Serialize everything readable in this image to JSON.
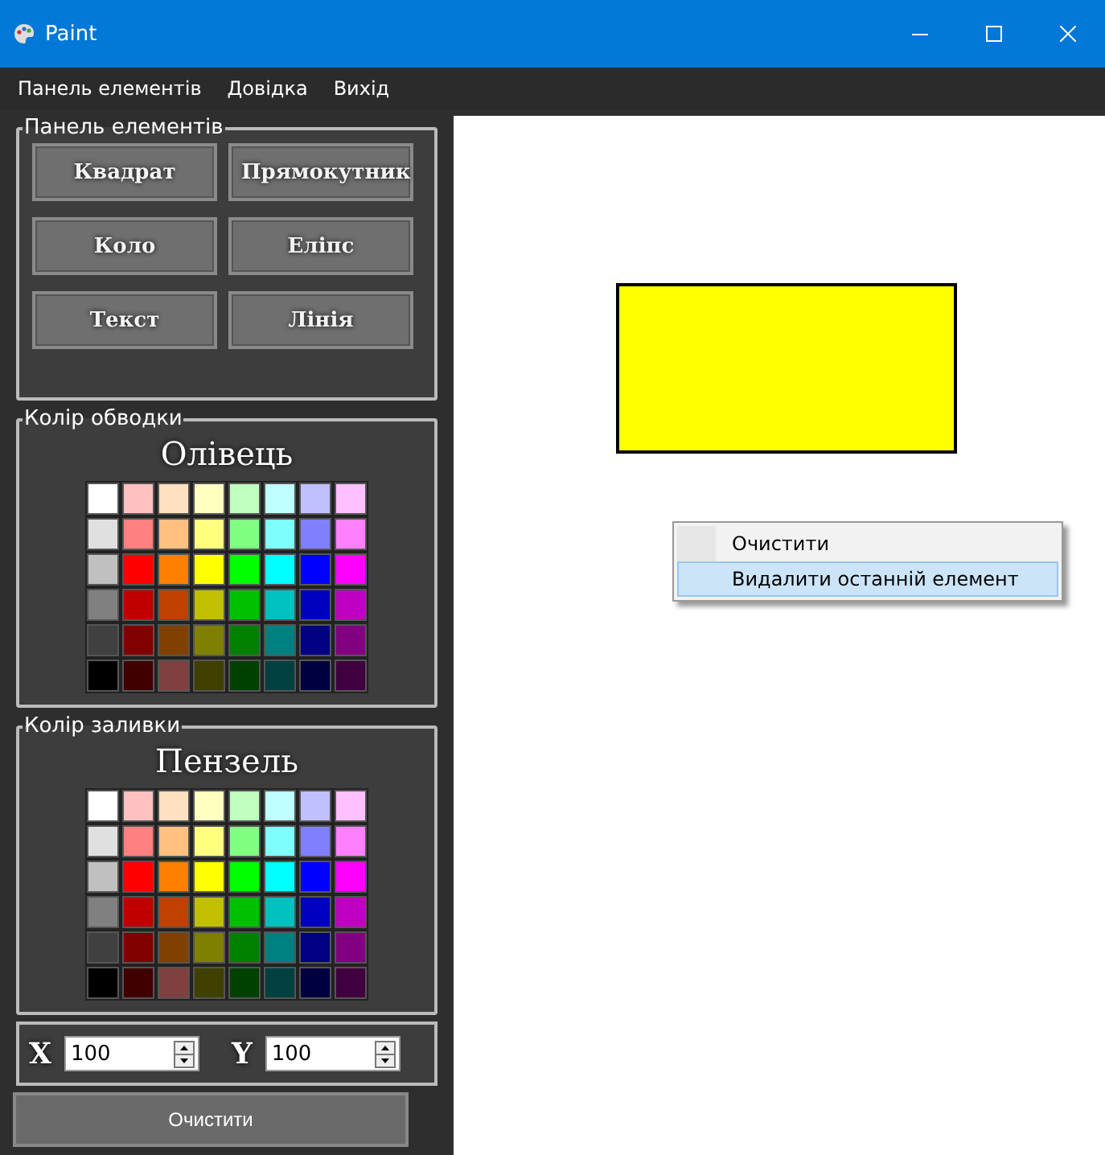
{
  "window": {
    "title": "Paint"
  },
  "menu": [
    "Панель елементів",
    "Довідка",
    "Вихід"
  ],
  "elements_panel": {
    "title": "Панель елементів",
    "buttons": [
      "Квадрат",
      "Прямокутник",
      "Коло",
      "Еліпс",
      "Текст",
      "Лінія"
    ]
  },
  "stroke_panel": {
    "title": "Колір обводки",
    "heading": "Олівець",
    "swatches": [
      {
        "color": "#ffffff"
      },
      {
        "color": "#ffc0c0"
      },
      {
        "color": "#ffe0c0"
      },
      {
        "color": "#ffffc0"
      },
      {
        "color": "#c0ffc0"
      },
      {
        "color": "#c0ffff"
      },
      {
        "color": "#c0c0ff"
      },
      {
        "color": "#ffc0ff"
      },
      {
        "color": "#e0e0e0"
      },
      {
        "color": "#ff8080"
      },
      {
        "color": "#ffc080"
      },
      {
        "color": "#ffff80"
      },
      {
        "color": "#80ff80"
      },
      {
        "color": "#80ffff"
      },
      {
        "color": "#8080ff"
      },
      {
        "color": "#ff80ff"
      },
      {
        "color": "#c0c0c0"
      },
      {
        "color": "#ff0000"
      },
      {
        "color": "#ff8000"
      },
      {
        "color": "#ffff00"
      },
      {
        "color": "#00ff00"
      },
      {
        "color": "#00ffff"
      },
      {
        "color": "#0000ff"
      },
      {
        "color": "#ff00ff"
      },
      {
        "color": "#808080"
      },
      {
        "color": "#c00000"
      },
      {
        "color": "#c04000"
      },
      {
        "color": "#c0c000"
      },
      {
        "color": "#00c000"
      },
      {
        "color": "#00c0c0"
      },
      {
        "color": "#0000c0"
      },
      {
        "color": "#c000c0"
      },
      {
        "color": "#404040"
      },
      {
        "color": "#800000"
      },
      {
        "color": "#804000"
      },
      {
        "color": "#808000"
      },
      {
        "color": "#008000"
      },
      {
        "color": "#008080"
      },
      {
        "color": "#000080"
      },
      {
        "color": "#800080"
      },
      {
        "color": "#000000"
      },
      {
        "color": "#400000"
      },
      {
        "color": "#804040"
      },
      {
        "color": "#404000"
      },
      {
        "color": "#004000"
      },
      {
        "color": "#004040"
      },
      {
        "color": "#000040"
      },
      {
        "color": "#400040"
      }
    ]
  },
  "fill_panel": {
    "title": "Колір заливки",
    "heading": "Пензель",
    "swatches": [
      {
        "color": "#ffffff"
      },
      {
        "color": "#ffc0c0"
      },
      {
        "color": "#ffe0c0"
      },
      {
        "color": "#ffffc0"
      },
      {
        "color": "#c0ffc0"
      },
      {
        "color": "#c0ffff"
      },
      {
        "color": "#c0c0ff"
      },
      {
        "color": "#ffc0ff"
      },
      {
        "color": "#e0e0e0"
      },
      {
        "color": "#ff8080"
      },
      {
        "color": "#ffc080"
      },
      {
        "color": "#ffff80"
      },
      {
        "color": "#80ff80"
      },
      {
        "color": "#80ffff"
      },
      {
        "color": "#8080ff"
      },
      {
        "color": "#ff80ff"
      },
      {
        "color": "#c0c0c0"
      },
      {
        "color": "#ff0000"
      },
      {
        "color": "#ff8000"
      },
      {
        "color": "#ffff00"
      },
      {
        "color": "#00ff00"
      },
      {
        "color": "#00ffff"
      },
      {
        "color": "#0000ff"
      },
      {
        "color": "#ff00ff"
      },
      {
        "color": "#808080"
      },
      {
        "color": "#c00000"
      },
      {
        "color": "#c04000"
      },
      {
        "color": "#c0c000"
      },
      {
        "color": "#00c000"
      },
      {
        "color": "#00c0c0"
      },
      {
        "color": "#0000c0"
      },
      {
        "color": "#c000c0"
      },
      {
        "color": "#404040"
      },
      {
        "color": "#800000"
      },
      {
        "color": "#804000"
      },
      {
        "color": "#808000"
      },
      {
        "color": "#008000"
      },
      {
        "color": "#008080"
      },
      {
        "color": "#000080"
      },
      {
        "color": "#800080"
      },
      {
        "color": "#000000"
      },
      {
        "color": "#400000"
      },
      {
        "color": "#804040"
      },
      {
        "color": "#404000"
      },
      {
        "color": "#004000"
      },
      {
        "color": "#004040"
      },
      {
        "color": "#000040"
      },
      {
        "color": "#400040"
      }
    ]
  },
  "coords": [
    {
      "label": "X",
      "value": "100"
    },
    {
      "label": "Y",
      "value": "100"
    }
  ],
  "clear_button": "Очистити",
  "canvas": {
    "shapes": [
      {
        "kind": "rectangle",
        "color": "#ffff00"
      }
    ]
  },
  "context_menu": [
    {
      "label": "Очистити",
      "selected": false
    },
    {
      "label": "Видалити останній елемент",
      "selected": true
    }
  ]
}
